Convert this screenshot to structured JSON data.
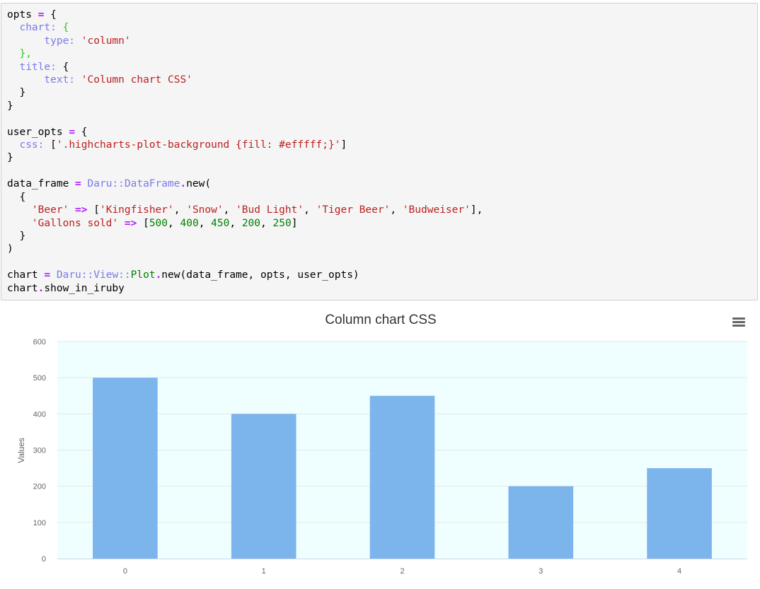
{
  "code_cell": {
    "lines": [
      [
        {
          "t": "opts "
        },
        {
          "t": "=",
          "c": "op"
        },
        {
          "t": " {"
        }
      ],
      [
        {
          "t": "  "
        },
        {
          "t": "chart:",
          "c": "key"
        },
        {
          "t": " {",
          "c": "green"
        }
      ],
      [
        {
          "t": "      "
        },
        {
          "t": "type:",
          "c": "key"
        },
        {
          "t": " "
        },
        {
          "t": "'column'",
          "c": "str"
        }
      ],
      [
        {
          "t": "  "
        },
        {
          "t": "},",
          "c": "green"
        }
      ],
      [
        {
          "t": "  "
        },
        {
          "t": "title:",
          "c": "key"
        },
        {
          "t": " {"
        }
      ],
      [
        {
          "t": "      "
        },
        {
          "t": "text:",
          "c": "key"
        },
        {
          "t": " "
        },
        {
          "t": "'Column chart CSS'",
          "c": "str"
        }
      ],
      [
        {
          "t": "  }"
        }
      ],
      [
        {
          "t": "}"
        }
      ],
      [
        {
          "t": ""
        }
      ],
      [
        {
          "t": "user_opts "
        },
        {
          "t": "=",
          "c": "op"
        },
        {
          "t": " {"
        }
      ],
      [
        {
          "t": "  "
        },
        {
          "t": "css:",
          "c": "key"
        },
        {
          "t": " ["
        },
        {
          "t": "'.highcharts-plot-background {fill: #efffff;}'",
          "c": "str"
        },
        {
          "t": "]"
        }
      ],
      [
        {
          "t": "}"
        }
      ],
      [
        {
          "t": ""
        }
      ],
      [
        {
          "t": "data_frame "
        },
        {
          "t": "=",
          "c": "op"
        },
        {
          "t": " "
        },
        {
          "t": "Daru",
          "c": "const"
        },
        {
          "t": "::",
          "c": "const"
        },
        {
          "t": "DataFrame",
          "c": "const"
        },
        {
          "t": ".",
          "c": "op"
        },
        {
          "t": "new("
        }
      ],
      [
        {
          "t": "  {"
        }
      ],
      [
        {
          "t": "    "
        },
        {
          "t": "'Beer'",
          "c": "str"
        },
        {
          "t": " "
        },
        {
          "t": "=>",
          "c": "op"
        },
        {
          "t": " ["
        },
        {
          "t": "'Kingfisher'",
          "c": "str"
        },
        {
          "t": ", "
        },
        {
          "t": "'Snow'",
          "c": "str"
        },
        {
          "t": ", "
        },
        {
          "t": "'Bud Light'",
          "c": "str"
        },
        {
          "t": ", "
        },
        {
          "t": "'Tiger Beer'",
          "c": "str"
        },
        {
          "t": ", "
        },
        {
          "t": "'Budweiser'",
          "c": "str"
        },
        {
          "t": "],"
        }
      ],
      [
        {
          "t": "    "
        },
        {
          "t": "'Gallons sold'",
          "c": "str"
        },
        {
          "t": " "
        },
        {
          "t": "=>",
          "c": "op"
        },
        {
          "t": " ["
        },
        {
          "t": "500",
          "c": "num"
        },
        {
          "t": ", "
        },
        {
          "t": "400",
          "c": "num"
        },
        {
          "t": ", "
        },
        {
          "t": "450",
          "c": "num"
        },
        {
          "t": ", "
        },
        {
          "t": "200",
          "c": "num"
        },
        {
          "t": ", "
        },
        {
          "t": "250",
          "c": "num"
        },
        {
          "t": "]"
        }
      ],
      [
        {
          "t": "  }"
        }
      ],
      [
        {
          "t": ")"
        }
      ],
      [
        {
          "t": ""
        }
      ],
      [
        {
          "t": "chart "
        },
        {
          "t": "=",
          "c": "op"
        },
        {
          "t": " "
        },
        {
          "t": "Daru",
          "c": "const"
        },
        {
          "t": "::",
          "c": "const"
        },
        {
          "t": "View",
          "c": "const"
        },
        {
          "t": "::",
          "c": "const"
        },
        {
          "t": "Plot",
          "c": "plot"
        },
        {
          "t": ".",
          "c": "op"
        },
        {
          "t": "new(data_frame, opts, user_opts)"
        }
      ],
      [
        {
          "t": "chart"
        },
        {
          "t": ".",
          "c": "op"
        },
        {
          "t": "show_in_iruby"
        }
      ]
    ]
  },
  "chart_data": {
    "type": "bar",
    "title": "Column chart CSS",
    "ylabel": "Values",
    "xlabel": "",
    "categories": [
      "0",
      "1",
      "2",
      "3",
      "4"
    ],
    "values": [
      500,
      400,
      450,
      200,
      250
    ],
    "ylim": [
      0,
      600
    ],
    "yticks": [
      0,
      100,
      200,
      300,
      400,
      500,
      600
    ],
    "grid": true,
    "legend": "none",
    "colors": {
      "bar": "#7cb5ec",
      "plot_background": "#efffff",
      "grid": "#e6e6e6",
      "axis": "#ccd6eb",
      "tick_label": "#666666",
      "title": "#333333"
    }
  },
  "menu": {
    "icon": "hamburger-menu-icon"
  }
}
